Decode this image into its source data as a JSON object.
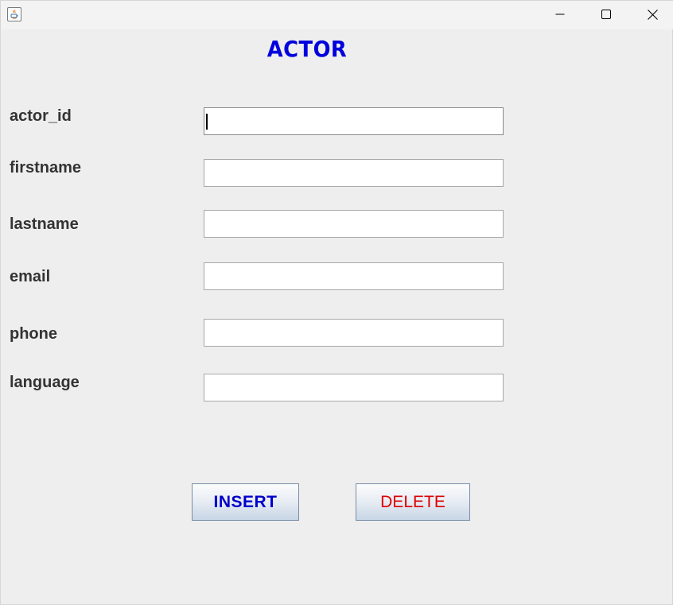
{
  "window": {
    "app_icon": "java-icon",
    "controls": {
      "minimize_icon": "minimize-icon",
      "maximize_icon": "maximize-icon",
      "close_icon": "close-icon"
    }
  },
  "form": {
    "title": "ACTOR",
    "title_color": "#0000dd",
    "fields": [
      {
        "label": "actor_id",
        "value": ""
      },
      {
        "label": "firstname",
        "value": ""
      },
      {
        "label": "lastname",
        "value": ""
      },
      {
        "label": "email",
        "value": ""
      },
      {
        "label": "phone",
        "value": ""
      },
      {
        "label": "language",
        "value": ""
      }
    ]
  },
  "buttons": {
    "insert_label": "INSERT",
    "insert_color": "#0000cc",
    "delete_label": "DELETE",
    "delete_color": "#dd0000"
  }
}
